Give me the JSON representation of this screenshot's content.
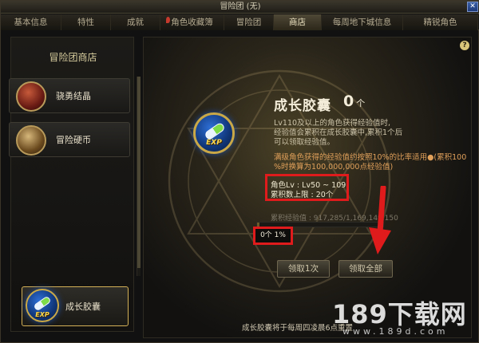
{
  "window": {
    "title": "冒险团 (无)"
  },
  "tabs": [
    {
      "label": "基本信息",
      "active": false
    },
    {
      "label": "特性",
      "active": false
    },
    {
      "label": "成就",
      "active": false
    },
    {
      "label": "角色收藏簿",
      "active": false,
      "pinned": true
    },
    {
      "label": "冒险团",
      "active": false
    },
    {
      "label": "商店",
      "active": true
    },
    {
      "label": "每周地下城信息",
      "active": false
    },
    {
      "label": "精锐角色",
      "active": false
    }
  ],
  "sidebar": {
    "title": "冒险团商店",
    "items": [
      {
        "label": "骁勇结晶",
        "icon": "crystal-icon"
      },
      {
        "label": "冒险硬币",
        "icon": "coin-chest-icon"
      }
    ],
    "selected": {
      "label": "成长胶囊",
      "icon": "exp-capsule-icon"
    }
  },
  "main": {
    "help": "?",
    "capsule": {
      "title": "成长胶囊",
      "count": "0",
      "count_unit": "个",
      "exp_label": "EXP"
    },
    "description_lines": [
      "Lv110及以上的角色获得经验值时,",
      "经验值会累积在成长胶囊中,累积1个后",
      "可以领取经验值。"
    ],
    "orange_lines": [
      "满级角色获得的经验值约按照10%的比率适用●(累积100",
      "%时换算为100,000,000点经验值)"
    ],
    "info": {
      "role_level": "角色Lv : Lv50 ~ 109",
      "limit": "累积数上限 : 20个"
    },
    "progress": {
      "label": "累积经验值 : 917,285/1,169,149,150",
      "percent": 1,
      "count_text": "0个 1%"
    },
    "buttons": {
      "claim_once": "领取1次",
      "claim_all": "领取全部"
    },
    "footer_note": "成长胶囊将于每周四凌晨6点重置"
  },
  "watermark": {
    "brand": "189下载网",
    "url": "www.189d.com"
  },
  "colors": {
    "highlight_box": "#e01b1b",
    "arrow": "#e01b1b",
    "gold_border": "#d4b057"
  }
}
